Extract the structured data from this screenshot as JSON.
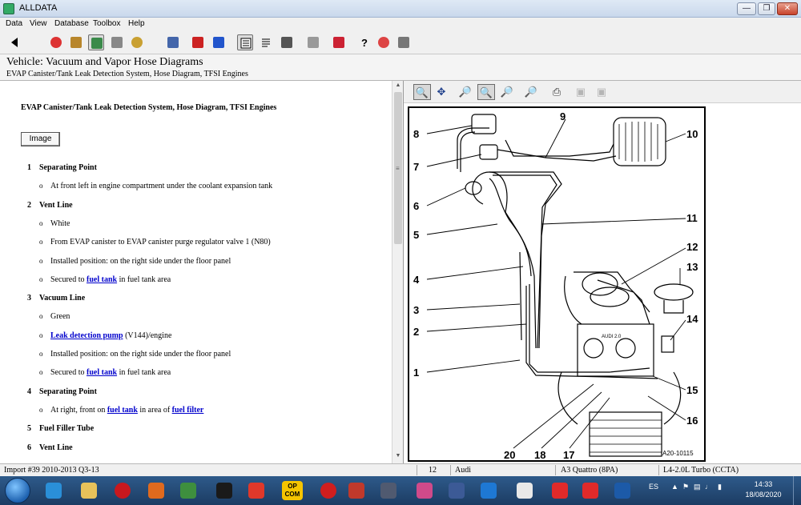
{
  "window": {
    "title": "ALLDATA",
    "controls": [
      "minimize",
      "restore",
      "close"
    ]
  },
  "menu": [
    "Data",
    "View",
    "Database",
    "Toolbox",
    "Help"
  ],
  "toolbar": {
    "icons": [
      "back-arrow-icon",
      "vehicle-select-icon",
      "garage-icon",
      "tsb-icon",
      "specs-icon",
      "component-icon",
      "wrench-icon",
      "new-car-icon",
      "car-icon",
      "document-view-icon",
      "list-icon",
      "camera-icon",
      "print-icon",
      "export-icon",
      "help-icon",
      "feedback-icon",
      "parts-icon"
    ]
  },
  "header": {
    "vehicle_line": "Vehicle:  Vacuum and Vapor Hose Diagrams",
    "subtitle": "EVAP Canister/Tank Leak Detection System, Hose Diagram, TFSI Engines"
  },
  "document": {
    "title": "EVAP Canister/Tank Leak Detection System, Hose Diagram, TFSI Engines",
    "image_button": "Image",
    "items": [
      {
        "num": "1",
        "head": "Separating Point",
        "bullets": [
          {
            "segs": [
              {
                "t": "At front left in engine compartment under the coolant expansion tank"
              }
            ]
          }
        ]
      },
      {
        "num": "2",
        "head": "Vent Line",
        "bullets": [
          {
            "segs": [
              {
                "t": "White"
              }
            ]
          },
          {
            "segs": [
              {
                "t": "From EVAP canister to EVAP canister purge regulator valve 1 (N80)"
              }
            ]
          },
          {
            "segs": [
              {
                "t": "Installed position: on the right side under the floor panel"
              }
            ]
          },
          {
            "segs": [
              {
                "t": "Secured to "
              },
              {
                "t": "fuel tank",
                "link": true
              },
              {
                "t": " in fuel tank area"
              }
            ]
          }
        ]
      },
      {
        "num": "3",
        "head": "Vacuum Line",
        "bullets": [
          {
            "segs": [
              {
                "t": "Green"
              }
            ]
          },
          {
            "segs": [
              {
                "t": "Leak detection pump",
                "link": true
              },
              {
                "t": " (V144)/engine"
              }
            ]
          },
          {
            "segs": [
              {
                "t": "Installed position: on the right side under the floor panel"
              }
            ]
          },
          {
            "segs": [
              {
                "t": "Secured to "
              },
              {
                "t": "fuel tank",
                "link": true
              },
              {
                "t": " in fuel tank area"
              }
            ]
          }
        ]
      },
      {
        "num": "4",
        "head": "Separating Point",
        "bullets": [
          {
            "segs": [
              {
                "t": "At right, front on "
              },
              {
                "t": "fuel tank",
                "link": true
              },
              {
                "t": " in area of "
              },
              {
                "t": "fuel filter",
                "link": true
              }
            ]
          }
        ]
      },
      {
        "num": "5",
        "head": "Fuel Filler Tube",
        "bullets": []
      },
      {
        "num": "6",
        "head": "Vent Line",
        "bullets": []
      }
    ]
  },
  "image_toolbar": {
    "icons": [
      "zoom-in-icon",
      "pan-icon",
      "zoom-area-icon",
      "zoom-fit-icon",
      "zoom-out-icon",
      "zoom-reset-icon",
      "print-icon",
      "camera-icon",
      "camera-save-icon"
    ]
  },
  "diagram": {
    "labels": [
      "1",
      "2",
      "3",
      "4",
      "5",
      "6",
      "7",
      "8",
      "9",
      "10",
      "11",
      "12",
      "13",
      "14",
      "15",
      "16",
      "17",
      "18",
      "20"
    ],
    "tag": "A20-10115",
    "emblem": "AUDI 2.0"
  },
  "status": {
    "import": "Import #39 2010-2013 Q3-13",
    "num": "12",
    "make": "Audi",
    "model": "A3 Quattro (8PA)",
    "engine": "L4-2.0L Turbo (CCTA)"
  },
  "taskbar": {
    "opcom": [
      "OP",
      "COM"
    ],
    "lang": "ES",
    "time": "14:33",
    "date": "18/08/2020",
    "colors": [
      "#d0d8e0",
      "#2a8fd8",
      "#e8c25a",
      "#c8181e",
      "#e06a1e",
      "#3e8f3e",
      "#1a1a1a",
      "#e0382a",
      "#f5c400",
      "#d01e1e",
      "#c0392b",
      "#505a70",
      "#d04a8a",
      "#3c5a96",
      "#1e78d4",
      "#e8e8e8",
      "#e02a2a",
      "#e02a2a",
      "#1c5aa8"
    ]
  }
}
